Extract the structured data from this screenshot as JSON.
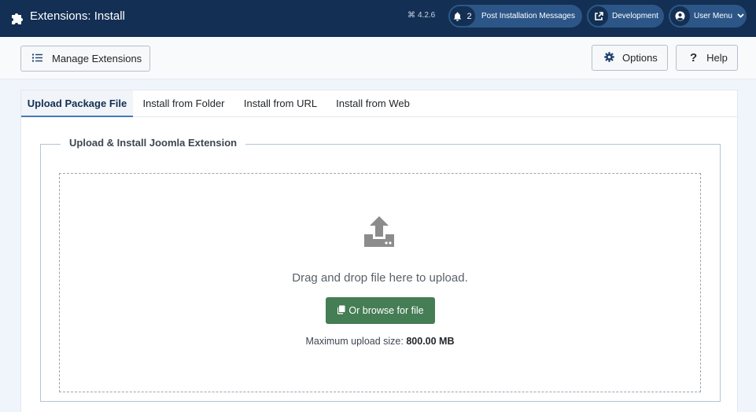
{
  "header": {
    "title": "Extensions: Install",
    "title_icon": "puzzle-icon",
    "version": "4.2.6",
    "post_count": "2",
    "post_label": "Post Installation Messages",
    "dev_label": "Development",
    "user_label": "User Menu"
  },
  "toolbar": {
    "manage_label": "Manage Extensions",
    "options_label": "Options",
    "help_label": "Help"
  },
  "tabs": [
    {
      "label": "Upload Package File",
      "active": true
    },
    {
      "label": "Install from Folder",
      "active": false
    },
    {
      "label": "Install from URL",
      "active": false
    },
    {
      "label": "Install from Web",
      "active": false
    }
  ],
  "upload": {
    "legend": "Upload & Install Joomla Extension",
    "drag_text": "Drag and drop file here to upload.",
    "browse_label": "Or browse for file",
    "max_label": "Maximum upload size:",
    "max_value": "800.00 MB"
  },
  "colors": {
    "header_bg": "#132f53",
    "pill_bg": "#2c5687",
    "browse_bg": "#457d54",
    "tab_active": "#457ab8"
  }
}
